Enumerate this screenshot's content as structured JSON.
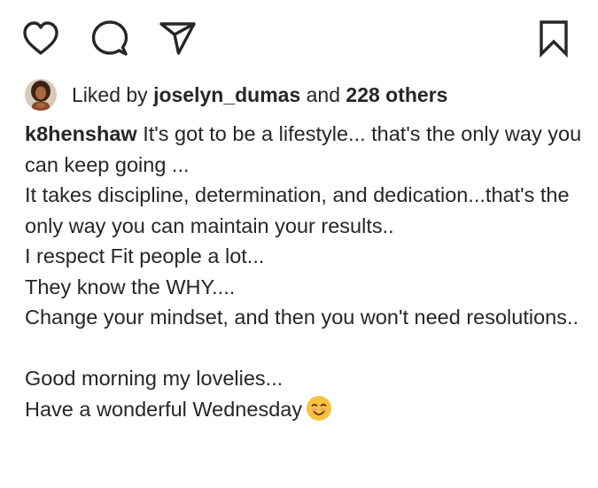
{
  "actions": {
    "like_icon": "heart-outline-icon",
    "comment_icon": "speech-bubble-icon",
    "share_icon": "paper-plane-icon",
    "save_icon": "bookmark-outline-icon"
  },
  "likes": {
    "prefix": "Liked by",
    "user": "joselyn_dumas",
    "connector": "and",
    "others": "228 others"
  },
  "caption": {
    "username": "k8henshaw",
    "text": "It's got to be a lifestyle... that's the only way you can keep going ...\nIt takes discipline, determination, and dedication...that's the only way you can maintain your results..\nI respect Fit people a lot...\nThey know the WHY....\nChange your mindset, and then you won't need resolutions..\n\nGood morning my lovelies...\nHave a wonderful Wednesday",
    "emoji": "smiling-face-emoji"
  },
  "colors": {
    "text": "#262626",
    "icon": "#262626",
    "emoji": "#F7C33C"
  }
}
